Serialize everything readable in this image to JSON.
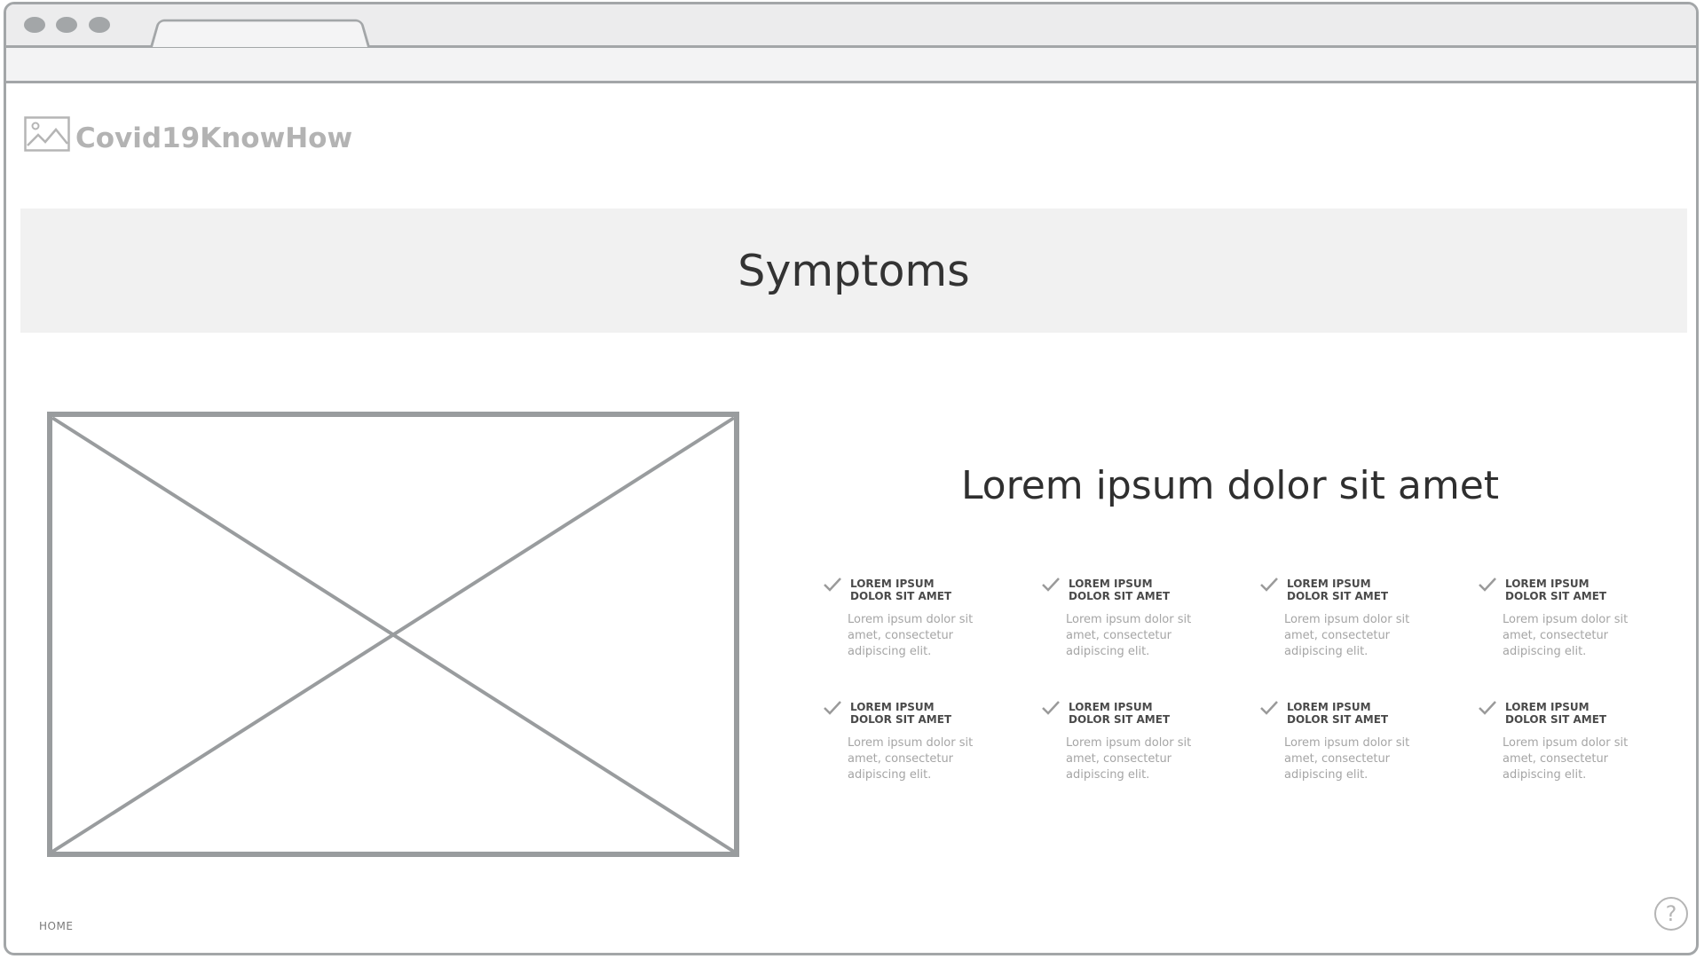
{
  "brand": {
    "name": "Covid19KnowHow"
  },
  "banner": {
    "title": "Symptoms"
  },
  "main": {
    "heading": "Lorem ipsum dolor sit amet",
    "features": [
      {
        "title_line1": "LOREM IPSUM",
        "title_line2": "DOLOR SIT AMET",
        "desc": "Lorem ipsum dolor sit amet, consectetur adipiscing elit."
      },
      {
        "title_line1": "LOREM IPSUM",
        "title_line2": "DOLOR SIT AMET",
        "desc": "Lorem ipsum dolor sit amet, consectetur adipiscing elit."
      },
      {
        "title_line1": "LOREM IPSUM",
        "title_line2": "DOLOR SIT AMET",
        "desc": "Lorem ipsum dolor sit amet, consectetur adipiscing elit."
      },
      {
        "title_line1": "LOREM IPSUM",
        "title_line2": "DOLOR SIT AMET",
        "desc": "Lorem ipsum dolor sit amet, consectetur adipiscing elit."
      },
      {
        "title_line1": "LOREM IPSUM",
        "title_line2": "DOLOR SIT AMET",
        "desc": "Lorem ipsum dolor sit amet, consectetur adipiscing elit."
      },
      {
        "title_line1": "LOREM IPSUM",
        "title_line2": "DOLOR SIT AMET",
        "desc": "Lorem ipsum dolor sit amet, consectetur adipiscing elit."
      },
      {
        "title_line1": "LOREM IPSUM",
        "title_line2": "DOLOR SIT AMET",
        "desc": "Lorem ipsum dolor sit amet, consectetur adipiscing elit."
      },
      {
        "title_line1": "LOREM IPSUM",
        "title_line2": "DOLOR SIT AMET",
        "desc": "Lorem ipsum dolor sit amet, consectetur adipiscing elit."
      }
    ]
  },
  "footer": {
    "home_label": "HOME",
    "help_label": "?"
  },
  "icons": {
    "logo": "image-placeholder-icon",
    "check": "check-icon",
    "help": "help-icon"
  },
  "colors": {
    "wire": "#a3a6a8",
    "banner_bg": "#f1f1f1",
    "text_dark": "#333333",
    "text_muted": "#a5a5a5"
  }
}
